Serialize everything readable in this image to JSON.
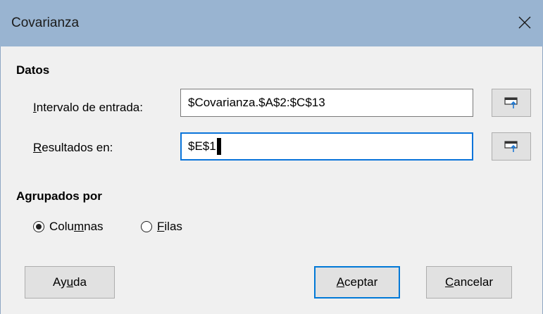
{
  "window": {
    "title": "Covarianza"
  },
  "datos": {
    "heading": "Datos",
    "input_range": {
      "label_mnemonic": "I",
      "label_rest": "ntervalo de entrada:",
      "value": "$Covarianza.$A$2:$C$13"
    },
    "results": {
      "label_mnemonic": "R",
      "label_rest": "esultados en:",
      "value": "$E$1"
    }
  },
  "grouped": {
    "heading": "Agrupados por",
    "options": [
      {
        "label_pre": "Colu",
        "label_mnemonic": "m",
        "label_post": "nas",
        "selected": true
      },
      {
        "label_pre": "",
        "label_mnemonic": "F",
        "label_post": "ilas",
        "selected": false
      }
    ]
  },
  "buttons": {
    "help": {
      "pre": "Ay",
      "mnemonic": "u",
      "post": "da"
    },
    "ok": {
      "pre": "",
      "mnemonic": "A",
      "post": "ceptar"
    },
    "cancel": {
      "pre": "",
      "mnemonic": "C",
      "post": "ancelar"
    }
  },
  "icons": {
    "close": "close-icon",
    "shrink": "shrink-dialog-icon"
  },
  "colors": {
    "titlebar": "#99b4d1",
    "focus_border": "#0a74da",
    "default_button_border": "#0078d7"
  }
}
